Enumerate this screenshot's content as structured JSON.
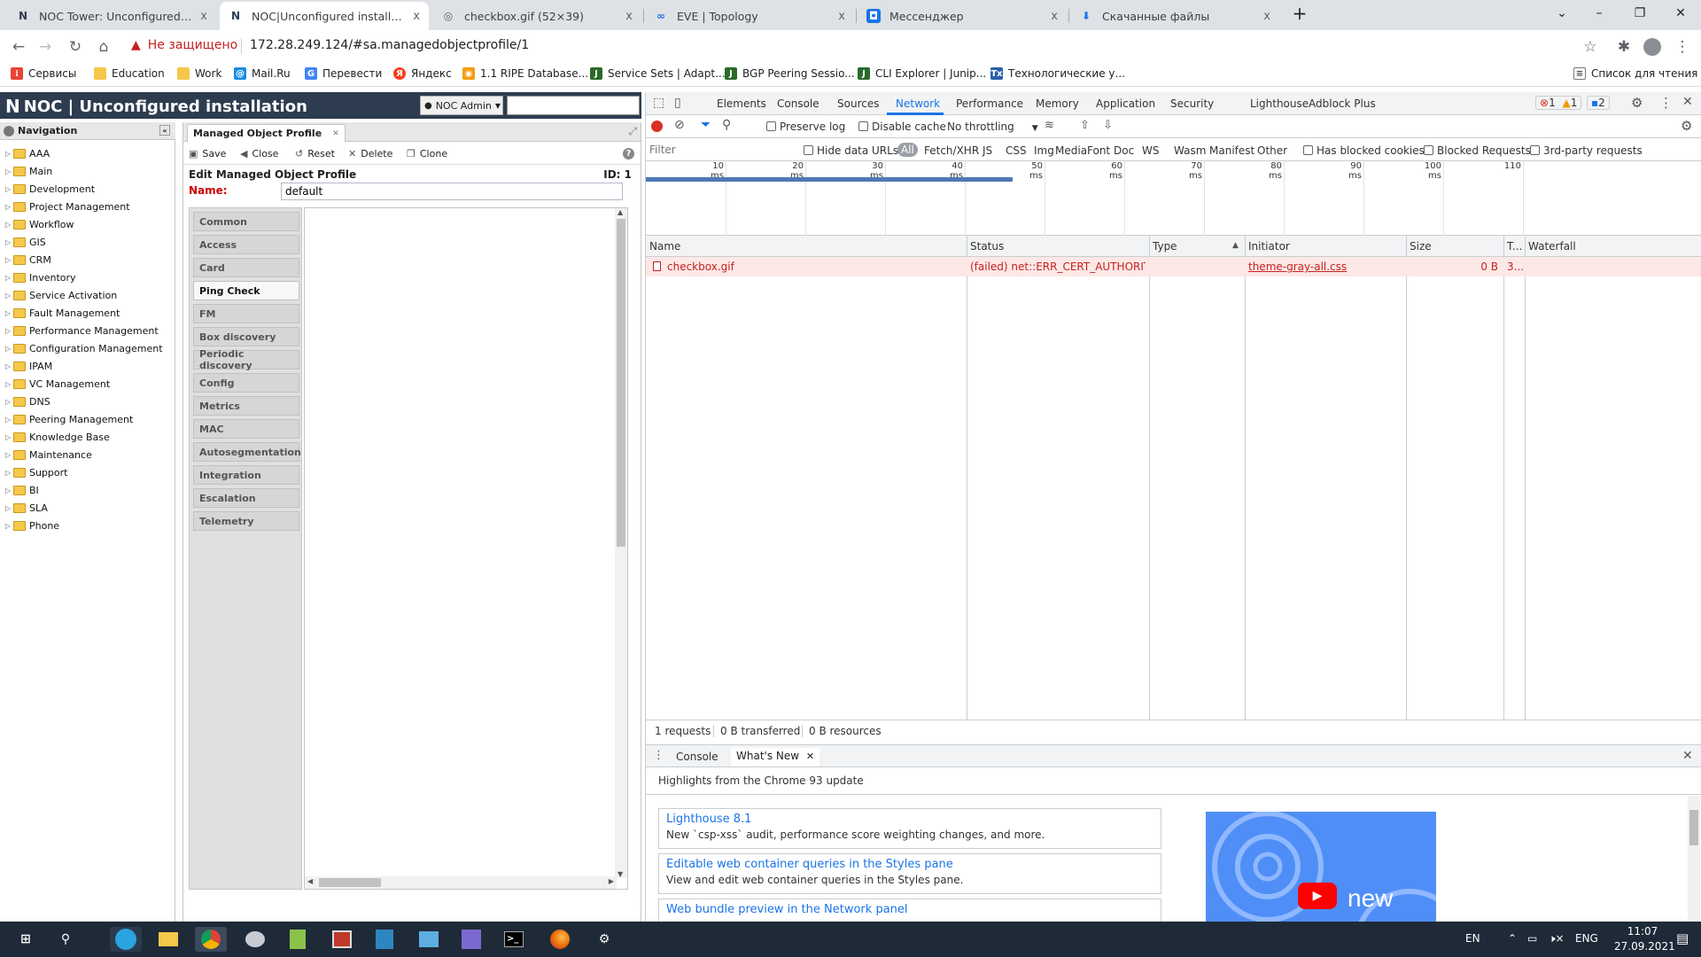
{
  "browser": {
    "tabs": [
      {
        "title": "NOC Tower: Unconfigured install",
        "close": "x",
        "active": false
      },
      {
        "title": "NOC|Unconfigured installation",
        "close": "x",
        "active": true
      },
      {
        "title": "checkbox.gif (52×39)",
        "close": "x",
        "active": false
      },
      {
        "title": "EVE | Topology",
        "close": "x",
        "active": false
      },
      {
        "title": "Мессенджер",
        "close": "x",
        "active": false
      },
      {
        "title": "Скачанные файлы",
        "close": "x",
        "active": false
      }
    ],
    "new_tab": "+",
    "window_buttons": {
      "minimize": "–",
      "maximize": "❐",
      "close": "✕"
    },
    "security_label": "Не защищено",
    "url": "172.28.249.124/#sa.managedobjectprofile/1",
    "bookmarks": [
      {
        "label": "Сервисы",
        "color": "#e94235"
      },
      {
        "label": "Education",
        "color": "#f5c84a"
      },
      {
        "label": "Work",
        "color": "#f5c84a"
      },
      {
        "label": "Mail.Ru",
        "color": "#168de2"
      },
      {
        "label": "Перевести",
        "color": "#4285f4"
      },
      {
        "label": "Яндекс",
        "color": "#fc3f1d"
      },
      {
        "label": "1.1 RIPE Database...",
        "color": "#f39c12"
      },
      {
        "label": "Service Sets | Adapt...",
        "color": "#2b6a2b"
      },
      {
        "label": "BGP Peering Sessio...",
        "color": "#2b6a2b"
      },
      {
        "label": "CLI Explorer | Junip...",
        "color": "#2b6a2b"
      },
      {
        "label": "Технологические у...",
        "color": "#2b5fa8"
      }
    ],
    "reading_list": "Список для чтения"
  },
  "noc": {
    "title": "NOC | Unconfigured installation",
    "logo": "NOC|",
    "user": "NOC Admin",
    "navigation": {
      "header": "Navigation",
      "items": [
        "AAA",
        "Main",
        "Development",
        "Project Management",
        "Workflow",
        "GIS",
        "CRM",
        "Inventory",
        "Service Activation",
        "Fault Management",
        "Performance Management",
        "Configuration Management",
        "IPAM",
        "VC Management",
        "DNS",
        "Peering Management",
        "Knowledge Base",
        "Maintenance",
        "Support",
        "BI",
        "SLA",
        "Phone"
      ]
    },
    "editor": {
      "tab": "Managed Object Profile",
      "toolbar": {
        "save": "Save",
        "close": "Close",
        "reset": "Reset",
        "delete": "Delete",
        "clone": "Clone"
      },
      "form_title": "Edit Managed Object Profile",
      "id_label": "ID: 1",
      "name_label": "Name:",
      "name_value": "default",
      "side_tabs": [
        "Common",
        "Access",
        "Card",
        "Ping Check",
        "FM",
        "Box discovery",
        "Periodic discovery",
        "Config",
        "Metrics",
        "MAC",
        "Autosegmentation",
        "Integration",
        "Escalation",
        "Telemetry"
      ],
      "active_side_tab": "Ping Check"
    }
  },
  "devtools": {
    "tabs": [
      "Elements",
      "Console",
      "Sources",
      "Network",
      "Performance",
      "Memory",
      "Application",
      "Security",
      "Lighthouse",
      "Adblock Plus"
    ],
    "active_tab": "Network",
    "badges": {
      "errors": "1",
      "warnings": "1",
      "messages": "2"
    },
    "toolbar": {
      "preserve_log": "Preserve log",
      "disable_cache": "Disable cache",
      "throttling": "No throttling"
    },
    "filter": {
      "placeholder": "Filter",
      "hide_data_urls": "Hide data URLs",
      "types": [
        "All",
        "Fetch/XHR",
        "JS",
        "CSS",
        "Img",
        "Media",
        "Font",
        "Doc",
        "WS",
        "Wasm",
        "Manifest",
        "Other"
      ],
      "has_blocked_cookies": "Has blocked cookies",
      "blocked_requests": "Blocked Requests",
      "third_party": "3rd-party requests"
    },
    "timeline_ticks": [
      "10 ms",
      "20 ms",
      "30 ms",
      "40 ms",
      "50 ms",
      "60 ms",
      "70 ms",
      "80 ms",
      "90 ms",
      "100 ms",
      "110"
    ],
    "columns": [
      "Name",
      "Status",
      "Type",
      "Initiator",
      "Size",
      "T...",
      "Waterfall"
    ],
    "rows": [
      {
        "name": "checkbox.gif",
        "status": "(failed) net::ERR_CERT_AUTHORITY_...",
        "type": "",
        "initiator": "theme-gray-all.css",
        "size": "0 B",
        "time": "3..."
      }
    ],
    "summary": {
      "requests": "1 requests",
      "transferred": "0 B transferred",
      "resources": "0 B resources"
    },
    "drawer": {
      "tabs": [
        "Console",
        "What's New"
      ],
      "active": "What's New",
      "highlight": "Highlights from the Chrome 93 update",
      "cards": [
        {
          "title": "Lighthouse 8.1",
          "desc": "New `csp-xss` audit, performance score weighting changes, and more."
        },
        {
          "title": "Editable web container queries in the Styles pane",
          "desc": "View and edit web container queries in the Styles pane."
        },
        {
          "title": "Web bundle preview in the Network panel",
          "desc": ""
        }
      ],
      "promo_text": "new"
    }
  },
  "taskbar": {
    "lang1": "EN",
    "lang2": "ENG",
    "time": "11:07",
    "date": "27.09.2021"
  }
}
